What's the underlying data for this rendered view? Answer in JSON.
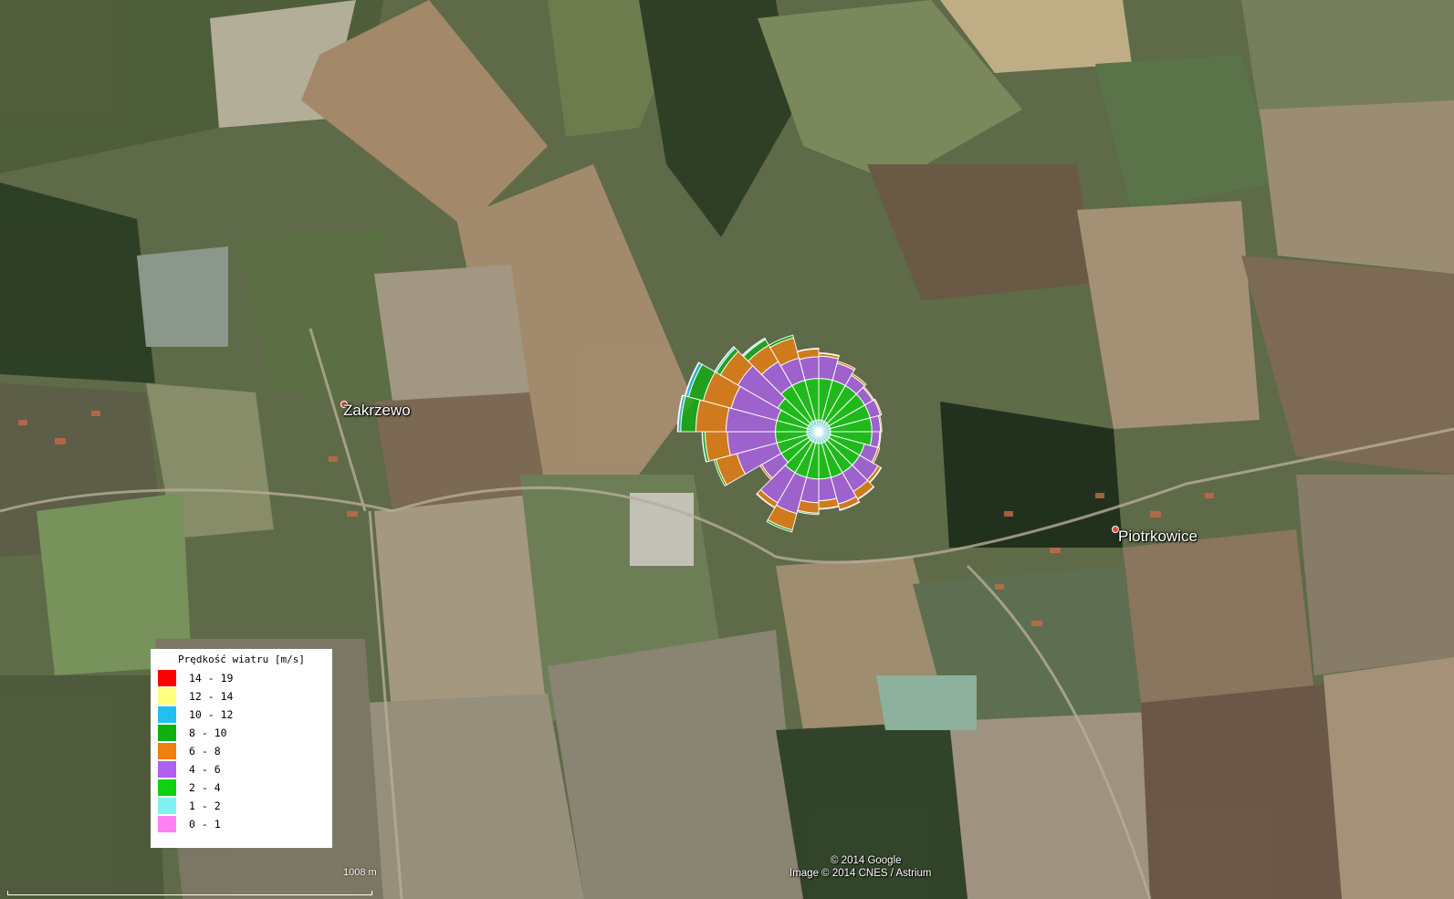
{
  "map": {
    "imagery": "satellite",
    "places": [
      {
        "name": "Zakrzewo"
      },
      {
        "name": "Piotrkowice"
      }
    ],
    "credits": {
      "copyright": "© 2014 Google",
      "imagery": "Image © 2014 CNES / Astrium"
    },
    "scale": {
      "label": "1008 m"
    }
  },
  "legend": {
    "title": "Prędkość wiatru [m/s]",
    "items": [
      {
        "range": "14 - 19",
        "color": "#ff0000"
      },
      {
        "range": "12 - 14",
        "color": "#ffff80"
      },
      {
        "range": "10 - 12",
        "color": "#22bfef"
      },
      {
        "range": "8 - 10",
        "color": "#10b010"
      },
      {
        "range": "6 - 8",
        "color": "#ef7f10"
      },
      {
        "range": "4 - 6",
        "color": "#b060f0"
      },
      {
        "range": "2 - 4",
        "color": "#10d010"
      },
      {
        "range": "1 - 2",
        "color": "#80f0f0"
      },
      {
        "range": "0 - 1",
        "color": "#ff80f0"
      }
    ]
  },
  "wind_rose": {
    "sector_count": 24,
    "speed_bins": [
      "0 - 1",
      "1 - 2",
      "2 - 4",
      "4 - 6",
      "6 - 8",
      "8 - 10",
      "10 - 12",
      "12 - 14",
      "14 - 19"
    ],
    "sectors": [
      {
        "bins": [
          0.3,
          1.5,
          6.3,
          3.4,
          0.4,
          0.1,
          0,
          0,
          0
        ]
      },
      {
        "bins": [
          0.3,
          1.5,
          6.3,
          2.7,
          0.3,
          0,
          0,
          0,
          0
        ]
      },
      {
        "bins": [
          0.3,
          1.5,
          6.3,
          1.8,
          0.3,
          0,
          0,
          0,
          0
        ]
      },
      {
        "bins": [
          0.3,
          1.5,
          6.3,
          1.4,
          0.2,
          0,
          0,
          0,
          0
        ]
      },
      {
        "bins": [
          0.3,
          1.5,
          6.3,
          1.6,
          0.2,
          0,
          0,
          0,
          0
        ]
      },
      {
        "bins": [
          0.3,
          1.5,
          6.3,
          1.3,
          0.2,
          0,
          0,
          0,
          0
        ]
      },
      {
        "bins": [
          0.3,
          1.5,
          6.3,
          1.2,
          0.15,
          0,
          0,
          0,
          0
        ]
      },
      {
        "bins": [
          0.3,
          1.5,
          5.4,
          2.1,
          0.3,
          0,
          0,
          0,
          0
        ]
      },
      {
        "bins": [
          0.3,
          1.5,
          5.4,
          3.2,
          0.5,
          0.1,
          0,
          0,
          0
        ]
      },
      {
        "bins": [
          0.3,
          1.5,
          5.4,
          3.3,
          1.3,
          0.1,
          0,
          0,
          0
        ]
      },
      {
        "bins": [
          0.3,
          1.5,
          5.4,
          4.2,
          0.9,
          0.1,
          0,
          0,
          0
        ]
      },
      {
        "bins": [
          0.3,
          1.5,
          5.4,
          3.3,
          1.2,
          0.1,
          0,
          0,
          0
        ]
      },
      {
        "bins": [
          0.3,
          1.5,
          5.4,
          3.6,
          1.6,
          0.2,
          0,
          0,
          0
        ]
      },
      {
        "bins": [
          0.3,
          1.5,
          5.4,
          5.7,
          2.6,
          0.3,
          0,
          0,
          0
        ]
      },
      {
        "bins": [
          0.3,
          1.5,
          5.4,
          5.3,
          0.8,
          0.1,
          0,
          0,
          0
        ]
      },
      {
        "bins": [
          0.3,
          1.5,
          4.8,
          3.4,
          0.3,
          0,
          0,
          0,
          0
        ]
      },
      {
        "bins": [
          0.3,
          1.5,
          4.8,
          6.3,
          3.3,
          0.3,
          0,
          0,
          0
        ]
      },
      {
        "bins": [
          0.3,
          1.5,
          4.8,
          7.3,
          3.4,
          0.4,
          0.05,
          0,
          0
        ]
      },
      {
        "bins": [
          0.3,
          1.5,
          4.8,
          7.5,
          4.6,
          2.3,
          0.4,
          0.1,
          0
        ]
      },
      {
        "bins": [
          0.3,
          1.5,
          4.8,
          7.2,
          4.4,
          2.3,
          0.5,
          0.1,
          0
        ]
      },
      {
        "bins": [
          0.3,
          1.5,
          5.4,
          7.0,
          3.1,
          0.7,
          0.25,
          0.05,
          0
        ]
      },
      {
        "bins": [
          0.3,
          1.5,
          6.3,
          4.2,
          2.9,
          1.0,
          0.2,
          0.05,
          0
        ]
      },
      {
        "bins": [
          0.3,
          1.5,
          6.3,
          3.5,
          3.2,
          0.4,
          0,
          0,
          0
        ]
      },
      {
        "bins": [
          0.3,
          1.5,
          6.3,
          3.3,
          1.2,
          0.1,
          0,
          0,
          0
        ]
      }
    ]
  }
}
